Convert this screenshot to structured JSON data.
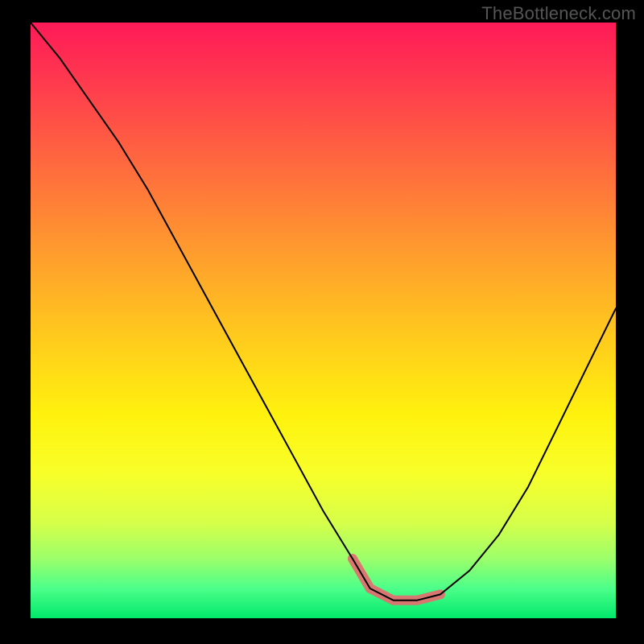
{
  "watermark": "TheBottleneck.com",
  "chart_data": {
    "type": "line",
    "title": "",
    "xlabel": "",
    "ylabel": "",
    "xlim": [
      0,
      100
    ],
    "ylim": [
      0,
      100
    ],
    "background_gradient": {
      "top": "#ff1a58",
      "bottom": "#00e86a",
      "meaning": "vertical gradient red→yellow→green (high→low)"
    },
    "series": [
      {
        "name": "curve",
        "color": "#000000",
        "x": [
          0,
          5,
          10,
          15,
          20,
          25,
          30,
          35,
          40,
          45,
          50,
          55,
          58,
          62,
          66,
          70,
          75,
          80,
          85,
          90,
          95,
          100
        ],
        "y": [
          100,
          94,
          87,
          80,
          72,
          63,
          54,
          45,
          36,
          27,
          18,
          10,
          5,
          3,
          3,
          4,
          8,
          14,
          22,
          32,
          42,
          52
        ]
      }
    ],
    "highlight": {
      "name": "optimal-range",
      "color": "#e07070",
      "x": [
        55,
        58,
        62,
        66,
        70
      ],
      "y": [
        10,
        5,
        3,
        3,
        4
      ],
      "note": "thick salmon overlay on trough of curve"
    },
    "grid": false,
    "legend": false
  }
}
